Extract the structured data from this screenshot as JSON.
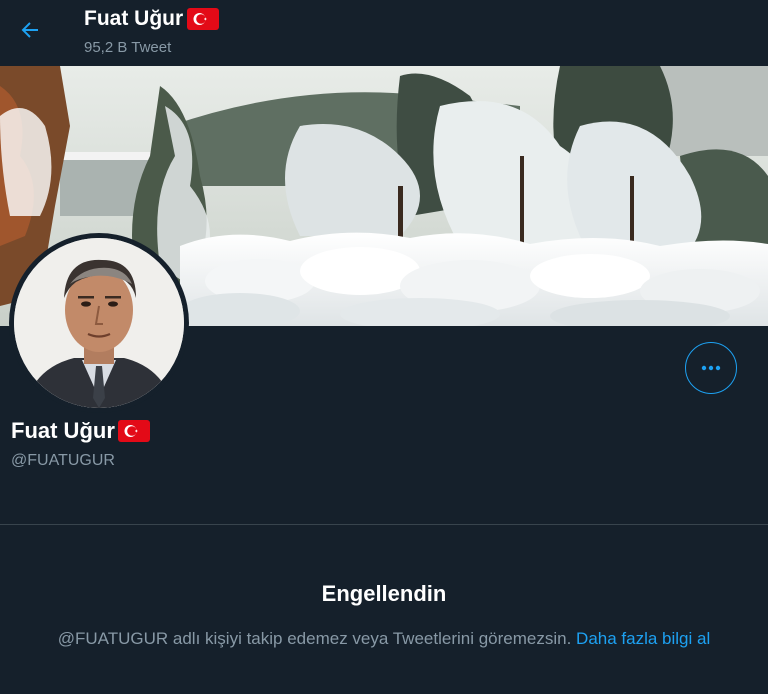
{
  "header": {
    "name": "Fuat Uğur",
    "tweet_count": "95,2 B Tweet"
  },
  "profile": {
    "name": "Fuat Uğur",
    "handle": "@FUATUGUR"
  },
  "blocked": {
    "title": "Engellendin",
    "message": "@FUATUGUR adlı kişiyi takip edemez veya Tweetlerini göremezsin.",
    "link": "Daha fazla bilgi al"
  },
  "icons": {
    "back": "arrow-left-icon",
    "more": "more-horizontal-icon",
    "flag": "turkey-flag-icon"
  },
  "colors": {
    "background": "#15202b",
    "accent": "#1da1f2",
    "secondary_text": "#8899a6",
    "divider": "#38444d",
    "flag_red": "#e30a17"
  }
}
